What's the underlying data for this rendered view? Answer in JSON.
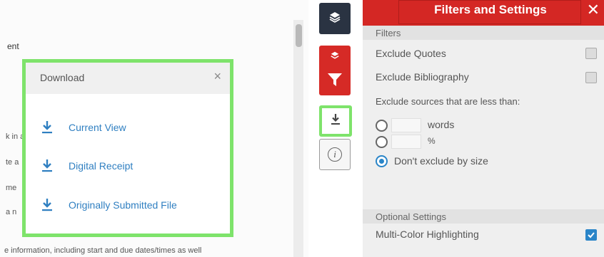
{
  "document": {
    "fragments": [
      "ent",
      "k in a",
      "te a",
      "me",
      "a n",
      "e information, including start and due dates/times as well"
    ]
  },
  "download_popup": {
    "title": "Download",
    "close_glyph": "×",
    "items": [
      {
        "label": "Current View",
        "icon": "download-icon"
      },
      {
        "label": "Digital Receipt",
        "icon": "download-icon"
      },
      {
        "label": "Originally Submitted File",
        "icon": "download-icon"
      }
    ]
  },
  "toolbar": {
    "buttons": [
      {
        "name": "layers",
        "icon": "layers-icon"
      },
      {
        "name": "filter",
        "icon": "filter-icon"
      },
      {
        "name": "download",
        "icon": "download-icon"
      },
      {
        "name": "info",
        "icon": "info-icon",
        "glyph": "i"
      }
    ]
  },
  "filters_panel": {
    "title": "Filters and Settings",
    "close_glyph": "✕",
    "filters_section": "Filters",
    "exclude_quotes": {
      "label": "Exclude Quotes",
      "checked": false
    },
    "exclude_bibliography": {
      "label": "Exclude Bibliography",
      "checked": false
    },
    "exclude_size_label": "Exclude sources that are less than:",
    "size_options": [
      {
        "unit": "words",
        "value": "",
        "selected": false
      },
      {
        "unit": "%",
        "value": "",
        "selected": false
      },
      {
        "label": "Don't exclude by size",
        "selected": true
      }
    ],
    "optional_section": "Optional Settings",
    "multi_color": {
      "label": "Multi-Color Highlighting",
      "checked": true
    }
  },
  "colors": {
    "accent_red": "#d42724",
    "highlight_green": "#7ee36b",
    "link_blue": "#2f7fc1",
    "toolbar_dark": "#2a3342"
  }
}
